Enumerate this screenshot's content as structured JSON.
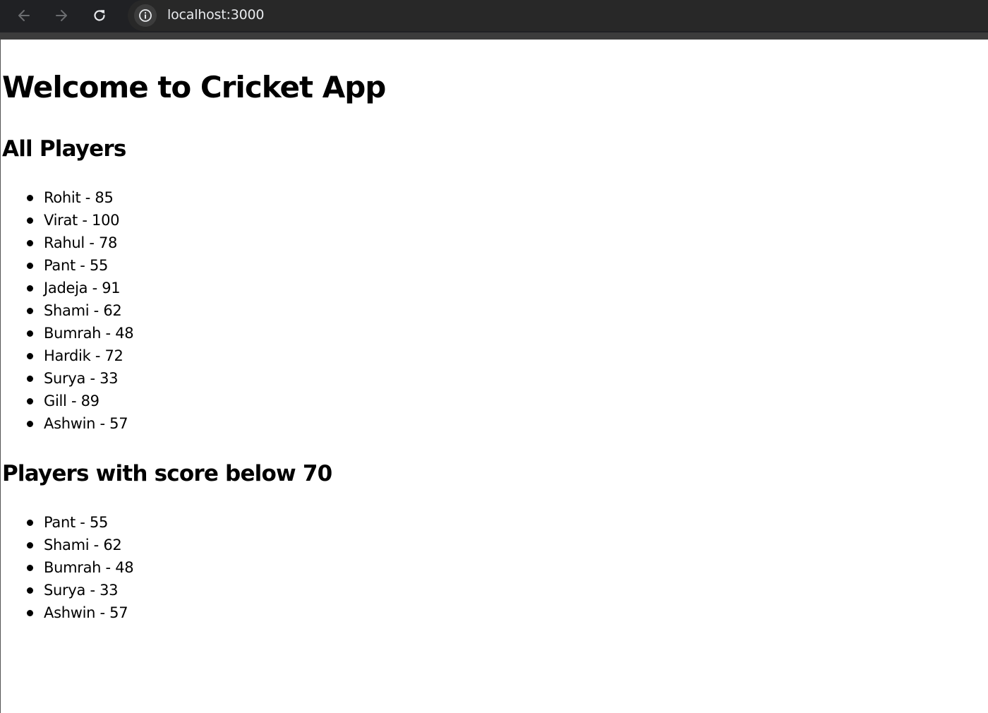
{
  "browser": {
    "url": "localhost:3000",
    "icons": {
      "back": "arrow-left-icon",
      "forward": "arrow-right-icon",
      "reload": "reload-icon",
      "site_info": "info-icon"
    }
  },
  "page": {
    "title": "Welcome to Cricket App",
    "all_players": {
      "heading": "All Players",
      "items": [
        "Rohit - 85",
        "Virat - 100",
        "Rahul - 78",
        "Pant - 55",
        "Jadeja - 91",
        "Shami - 62",
        "Bumrah - 48",
        "Hardik - 72",
        "Surya - 33",
        "Gill - 89",
        "Ashwin - 57"
      ]
    },
    "below_70": {
      "heading": "Players with score below 70",
      "items": [
        "Pant - 55",
        "Shami - 62",
        "Bumrah - 48",
        "Surya - 33",
        "Ashwin - 57"
      ]
    }
  }
}
